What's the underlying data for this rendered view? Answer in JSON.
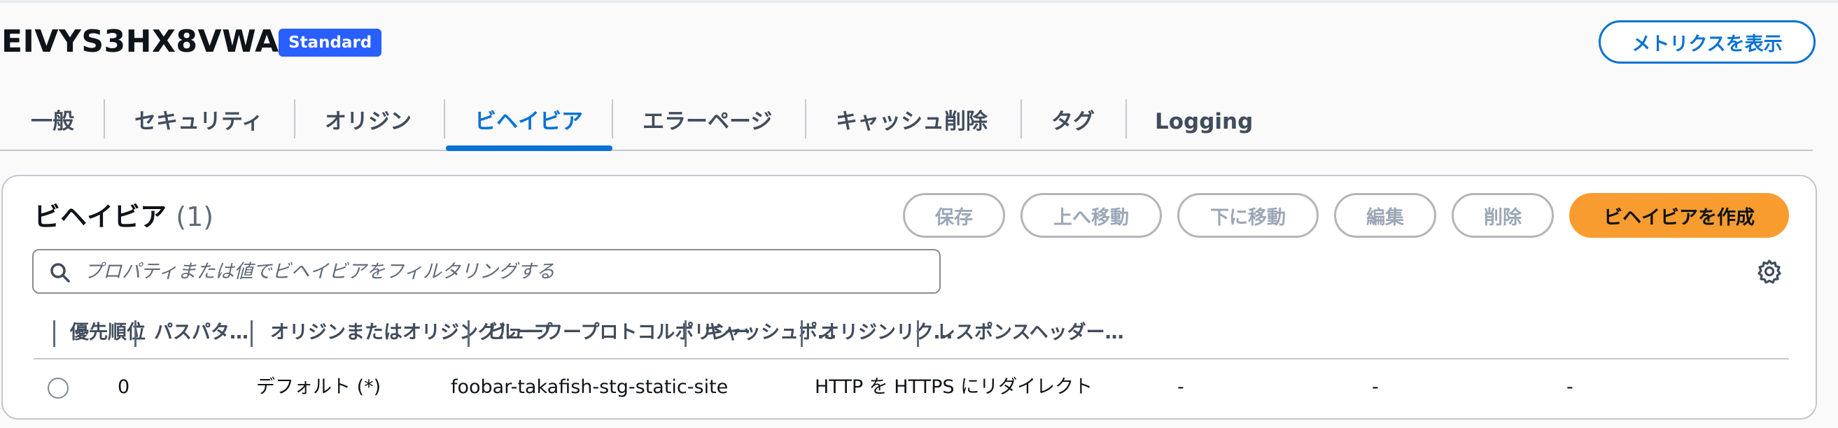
{
  "header": {
    "distribution_id": "EIVYS3HX8VWAX",
    "badge": "Standard",
    "metrics_button": "メトリクスを表示"
  },
  "tabs": [
    {
      "label": "一般"
    },
    {
      "label": "セキュリティ"
    },
    {
      "label": "オリジン"
    },
    {
      "label": "ビヘイビア",
      "active": true
    },
    {
      "label": "エラーページ"
    },
    {
      "label": "キャッシュ削除"
    },
    {
      "label": "タグ"
    },
    {
      "label": "Logging"
    }
  ],
  "panel": {
    "title": "ビヘイビア",
    "count": "(1)",
    "buttons": {
      "save": "保存",
      "move_up": "上へ移動",
      "move_down": "下に移動",
      "edit": "編集",
      "delete": "削除",
      "create": "ビヘイビアを作成"
    },
    "search_placeholder": "プロパティまたは値でビヘイビアをフィルタリングする"
  },
  "table": {
    "columns": [
      "優先順位",
      "パスパターン",
      "オリジンまたはオリジングループ",
      "ビューワープロトコルポリシー",
      "キャッシュポ…",
      "オリジンリク…",
      "レスポンスヘッダー…"
    ],
    "rows": [
      {
        "selected": false,
        "cells": [
          "0",
          "デフォルト (*)",
          "foobar-takafish-stg-static-site",
          "HTTP を HTTPS にリダイレクト",
          "-",
          "-",
          "-"
        ]
      }
    ]
  },
  "icons": {
    "search": "search-icon",
    "settings": "gear-icon"
  },
  "colors": {
    "accent_blue": "#0972d3",
    "badge_blue": "#295eff",
    "primary_orange": "#f89c30",
    "disabled_text": "#9ba7b6"
  }
}
